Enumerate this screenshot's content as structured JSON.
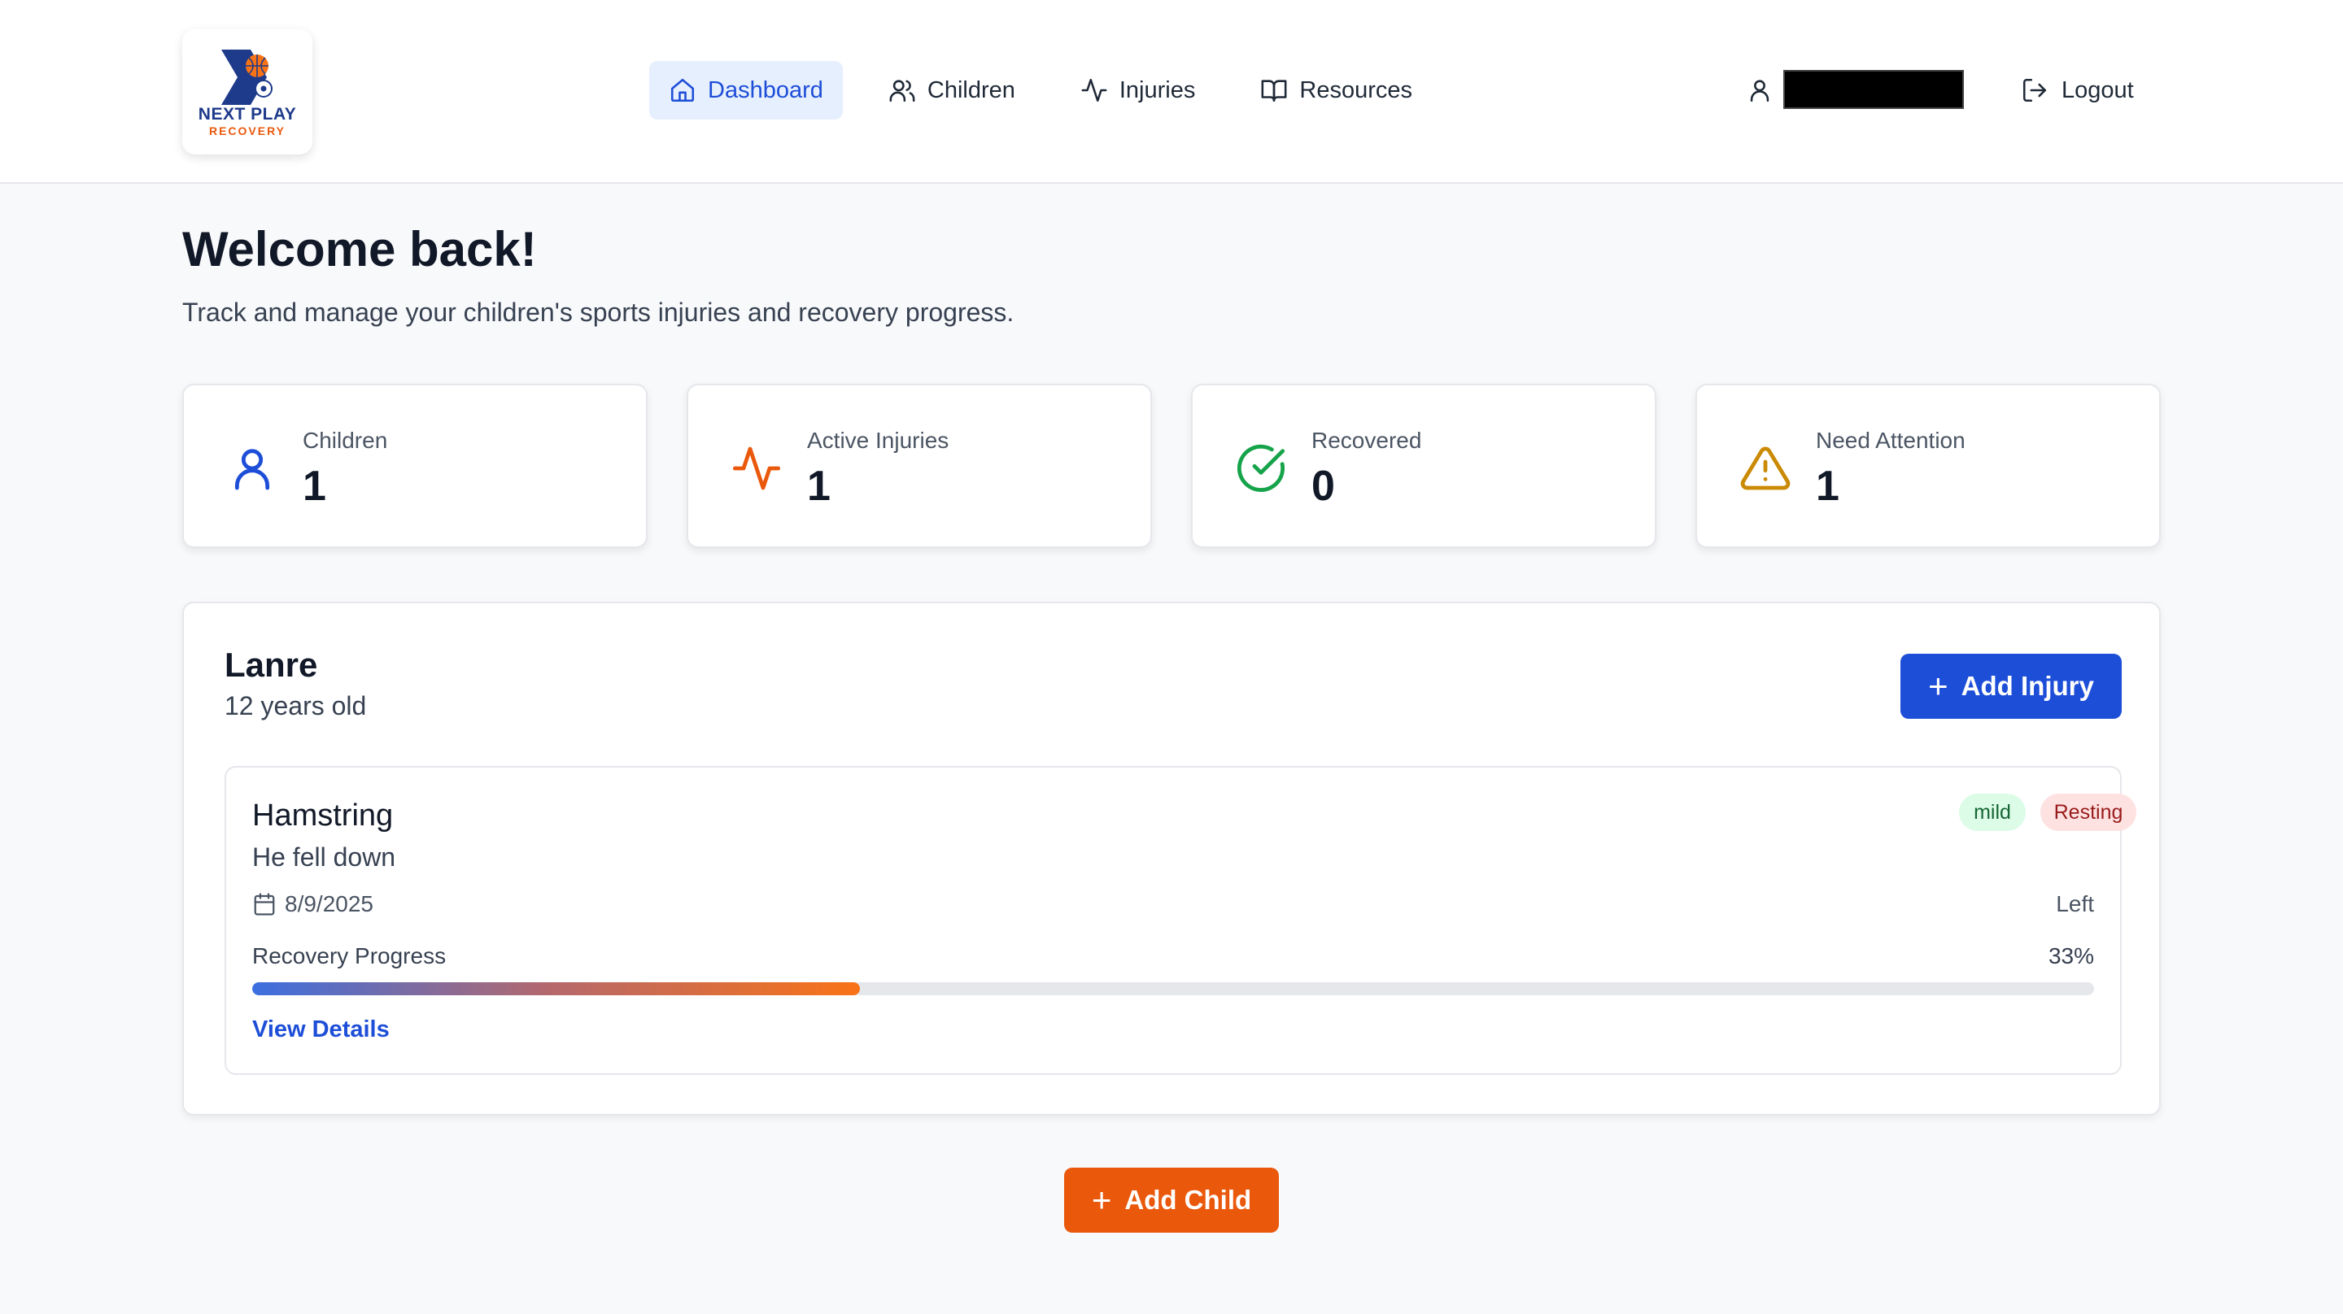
{
  "brand": {
    "line1": "NEXT PLAY",
    "line2": "RECOVERY"
  },
  "nav": {
    "dashboard": "Dashboard",
    "children": "Children",
    "injuries": "Injuries",
    "resources": "Resources"
  },
  "user": {
    "name": ""
  },
  "logout_label": "Logout",
  "page": {
    "title": "Welcome back!",
    "subtitle": "Track and manage your children's sports injuries and recovery progress."
  },
  "stats": {
    "children": {
      "label": "Children",
      "value": "1"
    },
    "active": {
      "label": "Active Injuries",
      "value": "1"
    },
    "recovered": {
      "label": "Recovered",
      "value": "0"
    },
    "attention": {
      "label": "Need Attention",
      "value": "1"
    }
  },
  "child": {
    "name": "Lanre",
    "age": "12 years old",
    "add_injury_label": "Add Injury",
    "injury": {
      "title": "Hamstring",
      "description": "He fell down",
      "severity": "mild",
      "status": "Resting",
      "date": "8/9/2025",
      "side": "Left",
      "progress_label": "Recovery Progress",
      "progress_text": "33%",
      "progress_fraction": 0.33,
      "view_details_label": "View Details"
    }
  },
  "add_child_label": "Add Child",
  "colors": {
    "primary": "#1d4ed8",
    "accent": "#ea580c",
    "success": "#16a34a",
    "warning": "#ca8a04",
    "danger": "#ea580c"
  },
  "icons": {
    "dashboard": "home-icon",
    "children": "users-icon",
    "injuries": "activity-icon",
    "resources": "book-icon",
    "user": "user-icon",
    "logout": "logout-icon",
    "stat_children": "user-icon",
    "stat_active": "activity-icon",
    "stat_recovered": "check-circle-icon",
    "stat_attention": "alert-triangle-icon",
    "date": "calendar-icon"
  }
}
